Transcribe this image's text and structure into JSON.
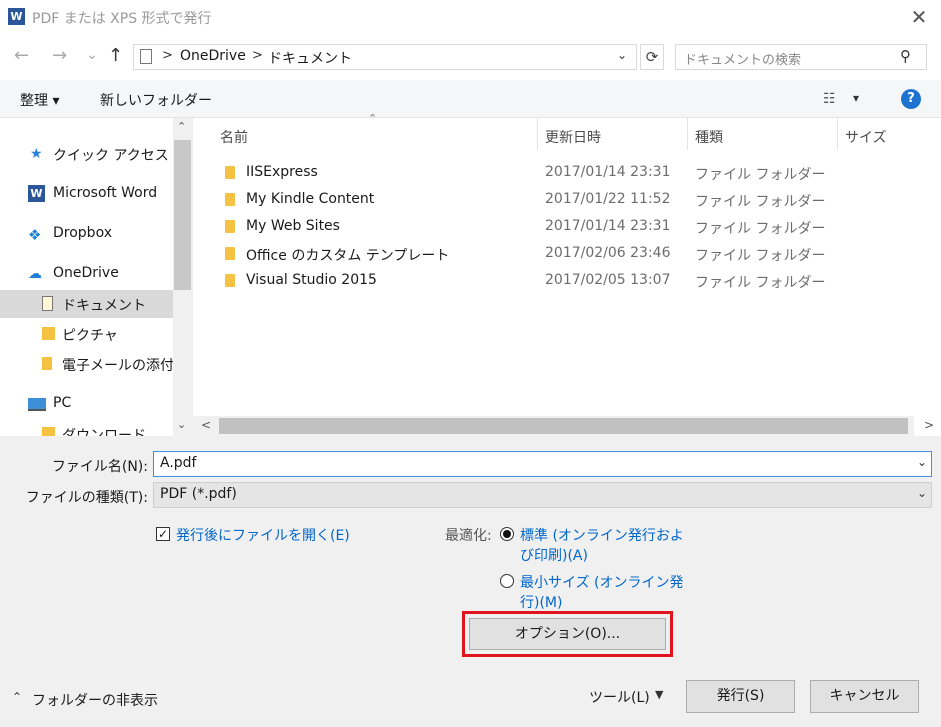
{
  "window": {
    "title": "PDF または XPS 形式で発行",
    "app_icon": "W",
    "close_glyph": "✕"
  },
  "nav": {
    "back": "←",
    "forward": "→",
    "history": "⌄",
    "up": "↑",
    "breadcrumb": [
      "OneDrive",
      "ドキュメント"
    ],
    "separator": ">",
    "search_placeholder": "ドキュメントの検索"
  },
  "toolbar": {
    "organize": "整理 ▾",
    "new_folder": "新しいフォルダー",
    "help": "?"
  },
  "sidebar": {
    "items": [
      {
        "label": "クイック アクセス",
        "icon": "star-icon"
      },
      {
        "label": "Microsoft Word",
        "icon": "word-icon"
      },
      {
        "label": "Dropbox",
        "icon": "dropbox-icon"
      },
      {
        "label": "OneDrive",
        "icon": "cloud-icon"
      },
      {
        "label": "ドキュメント",
        "icon": "documents-folder-icon"
      },
      {
        "label": "ピクチャ",
        "icon": "pictures-folder-icon"
      },
      {
        "label": "電子メールの添付フ",
        "icon": "folder-icon"
      },
      {
        "label": "PC",
        "icon": "computer-icon"
      },
      {
        "label": "ダウンロード",
        "icon": "downloads-folder-icon"
      }
    ]
  },
  "files": {
    "columns": [
      "名前",
      "更新日時",
      "種類",
      "サイズ"
    ],
    "rows": [
      {
        "name": "IISExpress",
        "date": "2017/01/14 23:31",
        "type": "ファイル フォルダー"
      },
      {
        "name": "My Kindle Content",
        "date": "2017/01/22 11:52",
        "type": "ファイル フォルダー"
      },
      {
        "name": "My Web Sites",
        "date": "2017/01/14 23:31",
        "type": "ファイル フォルダー"
      },
      {
        "name": "Office のカスタム テンプレート",
        "date": "2017/02/06 23:46",
        "type": "ファイル フォルダー"
      },
      {
        "name": "Visual Studio 2015",
        "date": "2017/02/05 13:07",
        "type": "ファイル フォルダー"
      }
    ]
  },
  "form": {
    "filename_label": "ファイル名(N):",
    "filename_value": "A.pdf",
    "filetype_label": "ファイルの種類(T):",
    "filetype_value": "PDF (*.pdf)",
    "open_after_label": "発行後にファイルを開く(E)",
    "open_after_checked": true,
    "optimize_label": "最適化:",
    "opt_standard_line1": "標準 (オンライン発行およ",
    "opt_standard_line2": "び印刷)(A)",
    "opt_min_line1": "最小サイズ (オンライン発",
    "opt_min_line2": "行)(M)",
    "selected_optimization": "standard",
    "options_button": "オプション(O)..."
  },
  "footer": {
    "hide_folders": "フォルダーの非表示",
    "tools": "ツール(L)",
    "publish": "発行(S)",
    "cancel": "キャンセル"
  },
  "colors": {
    "accent": "#0066cc",
    "highlight_border": "#e0141e",
    "folder": "#f5c242"
  }
}
